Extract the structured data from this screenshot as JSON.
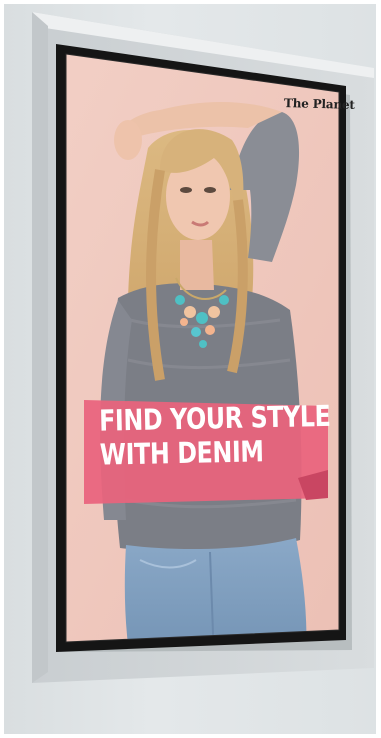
{
  "signage": {
    "brand": "The Planet",
    "headline": [
      "FIND YOUR STYLE",
      "WITH DENIM"
    ]
  },
  "colors": {
    "wall": "#dfe3e5",
    "frame": "#151515",
    "poster_background": "#f0c9bf",
    "banner": "#e9637d",
    "banner_text": "#ffffff",
    "sweater": "#7b7e86",
    "jeans": "#7f9fc0",
    "hair": "#d1ac74"
  }
}
